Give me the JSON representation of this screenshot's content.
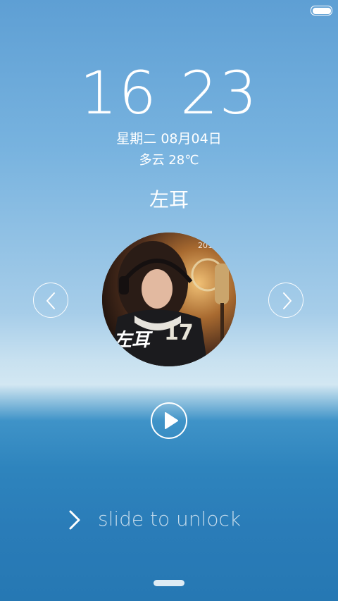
{
  "status": {
    "battery_level": 1.0
  },
  "lockscreen": {
    "hour": "16",
    "minute": "23",
    "date": "星期二 08月04日",
    "weather": "多云 28℃"
  },
  "music": {
    "song_title": "左耳",
    "cover_year": "201",
    "cover_title": "左耳"
  },
  "unlock": {
    "label": "slide to unlock"
  },
  "icons": {
    "prev": "chevron-left-icon",
    "next": "chevron-right-icon",
    "play": "play-icon",
    "unlock": "chevron-right-icon",
    "battery": "battery-icon"
  }
}
